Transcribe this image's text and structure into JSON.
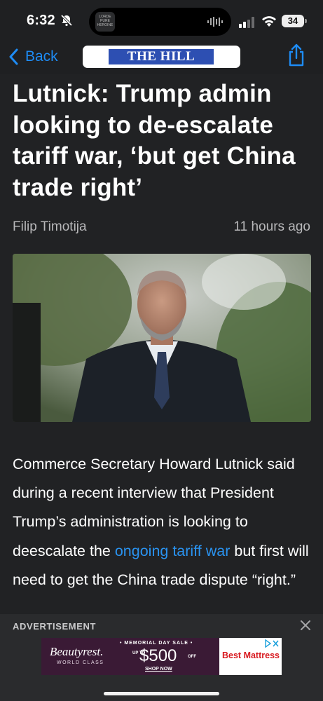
{
  "status_bar": {
    "time": "6:32",
    "battery": "34",
    "now_playing_art": "LORDE PURE HEROINE",
    "icons": [
      "bell-slash-icon",
      "audio-wave-icon",
      "cellular-signal-icon",
      "wifi-icon",
      "battery-icon"
    ]
  },
  "nav": {
    "back_label": "Back",
    "logo_text": "THE HILL",
    "share_icon": "share-icon",
    "accent": "#1e8cf5",
    "logo_color": "#2d4fb2"
  },
  "article": {
    "headline": "Lutnick: Trump admin looking to de-escalate tariff war, ‘but get China trade right’",
    "author": "Filip Timotija",
    "time_ago": "11 hours ago",
    "body_before_link": "Commerce Secretary Howard Lutnick said during a recent interview that President Trump’s administration is looking to deescalate the ",
    "body_link": "ongoing tar­iff war",
    "body_after_link": " but first will need to get the China trade dispute “right.”",
    "link_color": "#2a93f0"
  },
  "ad": {
    "label": "ADVERTISEMENT",
    "brand": "Beautyrest.",
    "brand_sub": "WORLD CLASS",
    "sale": "• MEMORIAL DAY SALE •",
    "upto": "UP TO",
    "amount": "$500",
    "off": "OFF",
    "shop": "SHOP NOW",
    "retailer": "Best Mattress",
    "close_icon": "close-icon",
    "adchoices_icon": "adchoices-icon"
  }
}
